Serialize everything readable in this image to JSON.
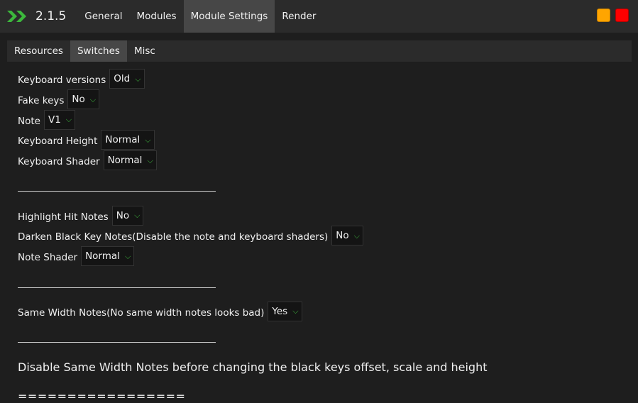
{
  "app": {
    "version": "2.1.5",
    "colors": {
      "accent": "#3cb83c",
      "minimize": "#ffa500",
      "close": "#ff0000"
    }
  },
  "main_tabs": [
    "General",
    "Modules",
    "Module Settings",
    "Render"
  ],
  "sub_tabs": [
    "Resources",
    "Switches",
    "Misc"
  ],
  "switches": {
    "keyboard_versions": {
      "label": "Keyboard versions",
      "value": "Old"
    },
    "fake_keys": {
      "label": "Fake keys",
      "value": "No"
    },
    "note": {
      "label": "Note",
      "value": "V1"
    },
    "keyboard_height": {
      "label": "Keyboard Height",
      "value": "Normal"
    },
    "keyboard_shader": {
      "label": "Keyboard Shader",
      "value": "Normal"
    },
    "highlight_hit_notes": {
      "label": "Highlight Hit Notes",
      "value": "No"
    },
    "darken_black_key_notes": {
      "label": "Darken Black Key Notes(Disable the note and keyboard shaders)",
      "value": "No"
    },
    "note_shader": {
      "label": "Note Shader",
      "value": "Normal"
    },
    "same_width_notes": {
      "label": "Same Width Notes(No same width notes looks bad)",
      "value": "Yes"
    }
  },
  "notice": "Disable Same Width Notes before changing the black keys offset, scale and height",
  "separator_text": "================="
}
